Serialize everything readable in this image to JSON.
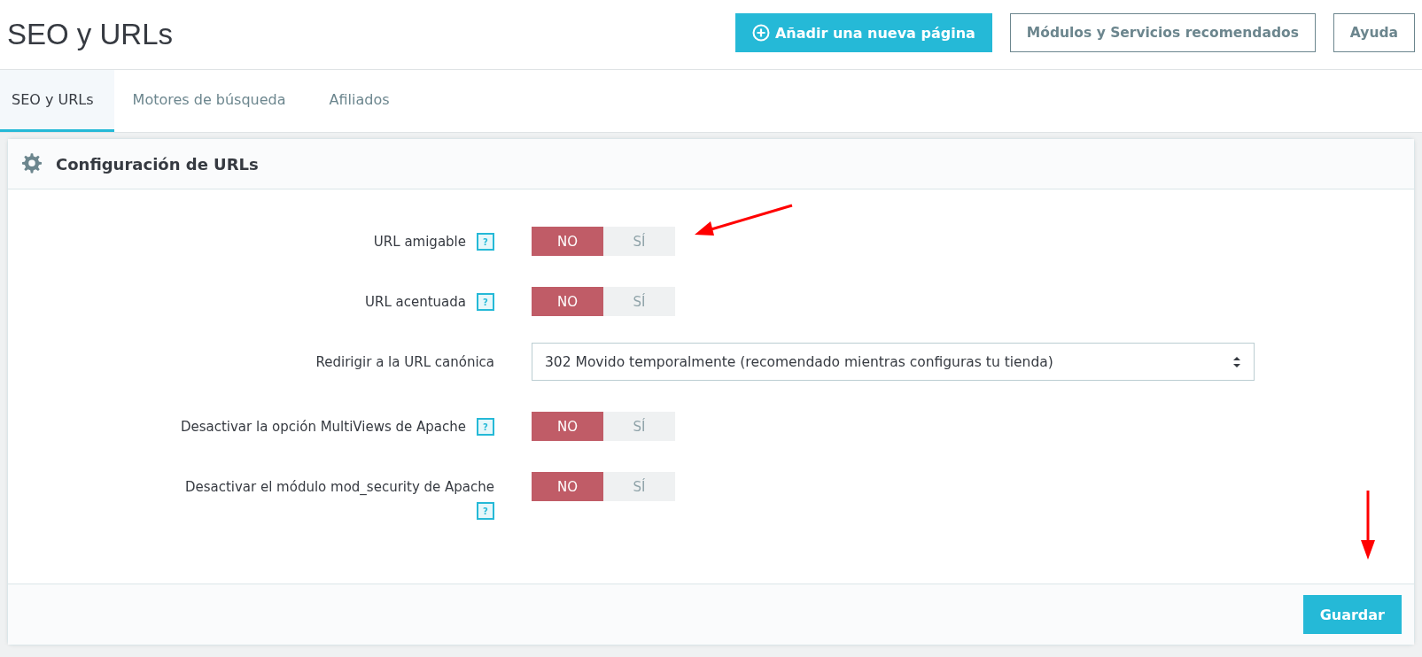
{
  "page_title": "SEO y URLs",
  "toolbar": [
    {
      "label": "Añadir una nueva página",
      "kind": "primary"
    },
    {
      "label": "Módulos y Servicios recomendados",
      "kind": "outline"
    },
    {
      "label": "Ayuda",
      "kind": "outline"
    }
  ],
  "tabs": [
    {
      "label": "SEO y URLs",
      "selected": true
    },
    {
      "label": "Motores de búsqueda",
      "selected": false
    },
    {
      "label": "Afiliados",
      "selected": false
    }
  ],
  "panel": {
    "title": "Configuración de URLs",
    "fields": [
      {
        "kind": "switch",
        "label": "URL amigable",
        "help": "?",
        "options": [
          {
            "label": "NO",
            "selected": true
          },
          {
            "label": "SÍ",
            "selected": false
          }
        ]
      },
      {
        "kind": "switch",
        "label": "URL acentuada",
        "help": "?",
        "options": [
          {
            "label": "NO",
            "selected": true
          },
          {
            "label": "SÍ",
            "selected": false
          }
        ]
      },
      {
        "kind": "select",
        "label": "Redirigir a la URL canónica",
        "value": "302 Movido temporalmente (recomendado mientras configuras tu tienda)"
      },
      {
        "kind": "switch",
        "label": "Desactivar la opción MultiViews de Apache",
        "help": "?",
        "options": [
          {
            "label": "NO",
            "selected": true
          },
          {
            "label": "SÍ",
            "selected": false
          }
        ]
      },
      {
        "kind": "switch",
        "label": "Desactivar el módulo mod_security de Apache",
        "help": "?",
        "help_below": true,
        "options": [
          {
            "label": "NO",
            "selected": true
          },
          {
            "label": "SÍ",
            "selected": false
          }
        ]
      }
    ],
    "save_button": "Guardar"
  }
}
